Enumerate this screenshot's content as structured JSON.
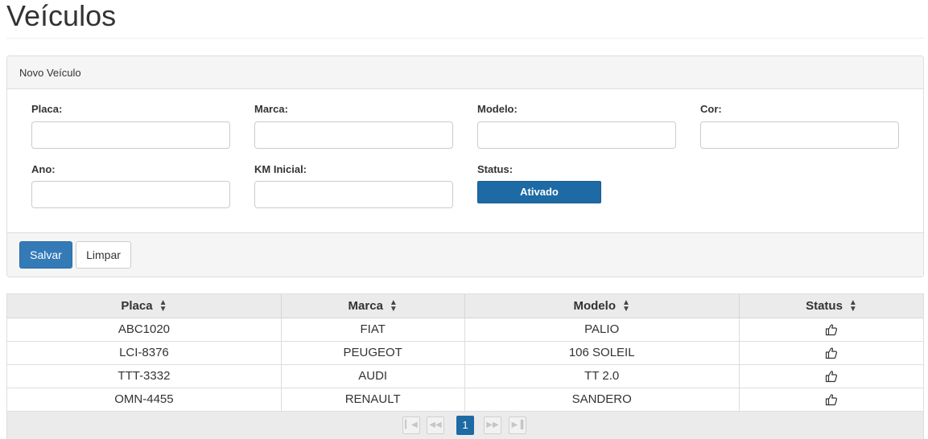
{
  "page": {
    "title": "Veículos"
  },
  "form": {
    "heading": "Novo Veículo",
    "fields": {
      "placa": {
        "label": "Placa:",
        "value": ""
      },
      "marca": {
        "label": "Marca:",
        "value": ""
      },
      "modelo": {
        "label": "Modelo:",
        "value": ""
      },
      "cor": {
        "label": "Cor:",
        "value": ""
      },
      "ano": {
        "label": "Ano:",
        "value": ""
      },
      "km_inicial": {
        "label": "KM Inicial:",
        "value": ""
      }
    },
    "status": {
      "label": "Status:",
      "value": "Ativado",
      "color": "#1d6aa5"
    },
    "buttons": {
      "save": "Salvar",
      "clear": "Limpar"
    }
  },
  "table": {
    "columns": [
      "Placa",
      "Marca",
      "Modelo",
      "Status"
    ],
    "rows": [
      {
        "placa": "ABC1020",
        "marca": "FIAT",
        "modelo": "PALIO",
        "status_icon": "thumbs-up-icon"
      },
      {
        "placa": "LCI-8376",
        "marca": "PEUGEOT",
        "modelo": "106 SOLEIL",
        "status_icon": "thumbs-up-icon"
      },
      {
        "placa": "TTT-3332",
        "marca": "AUDI",
        "modelo": "TT 2.0",
        "status_icon": "thumbs-up-icon"
      },
      {
        "placa": "OMN-4455",
        "marca": "RENAULT",
        "modelo": "SANDERO",
        "status_icon": "thumbs-up-icon"
      }
    ],
    "paginator": {
      "current_page": "1",
      "icons": [
        "first-page-icon",
        "prev-page-icon",
        "next-page-icon",
        "last-page-icon"
      ]
    }
  },
  "colors": {
    "primary": "#337ab7",
    "accent": "#1d6aa5"
  }
}
